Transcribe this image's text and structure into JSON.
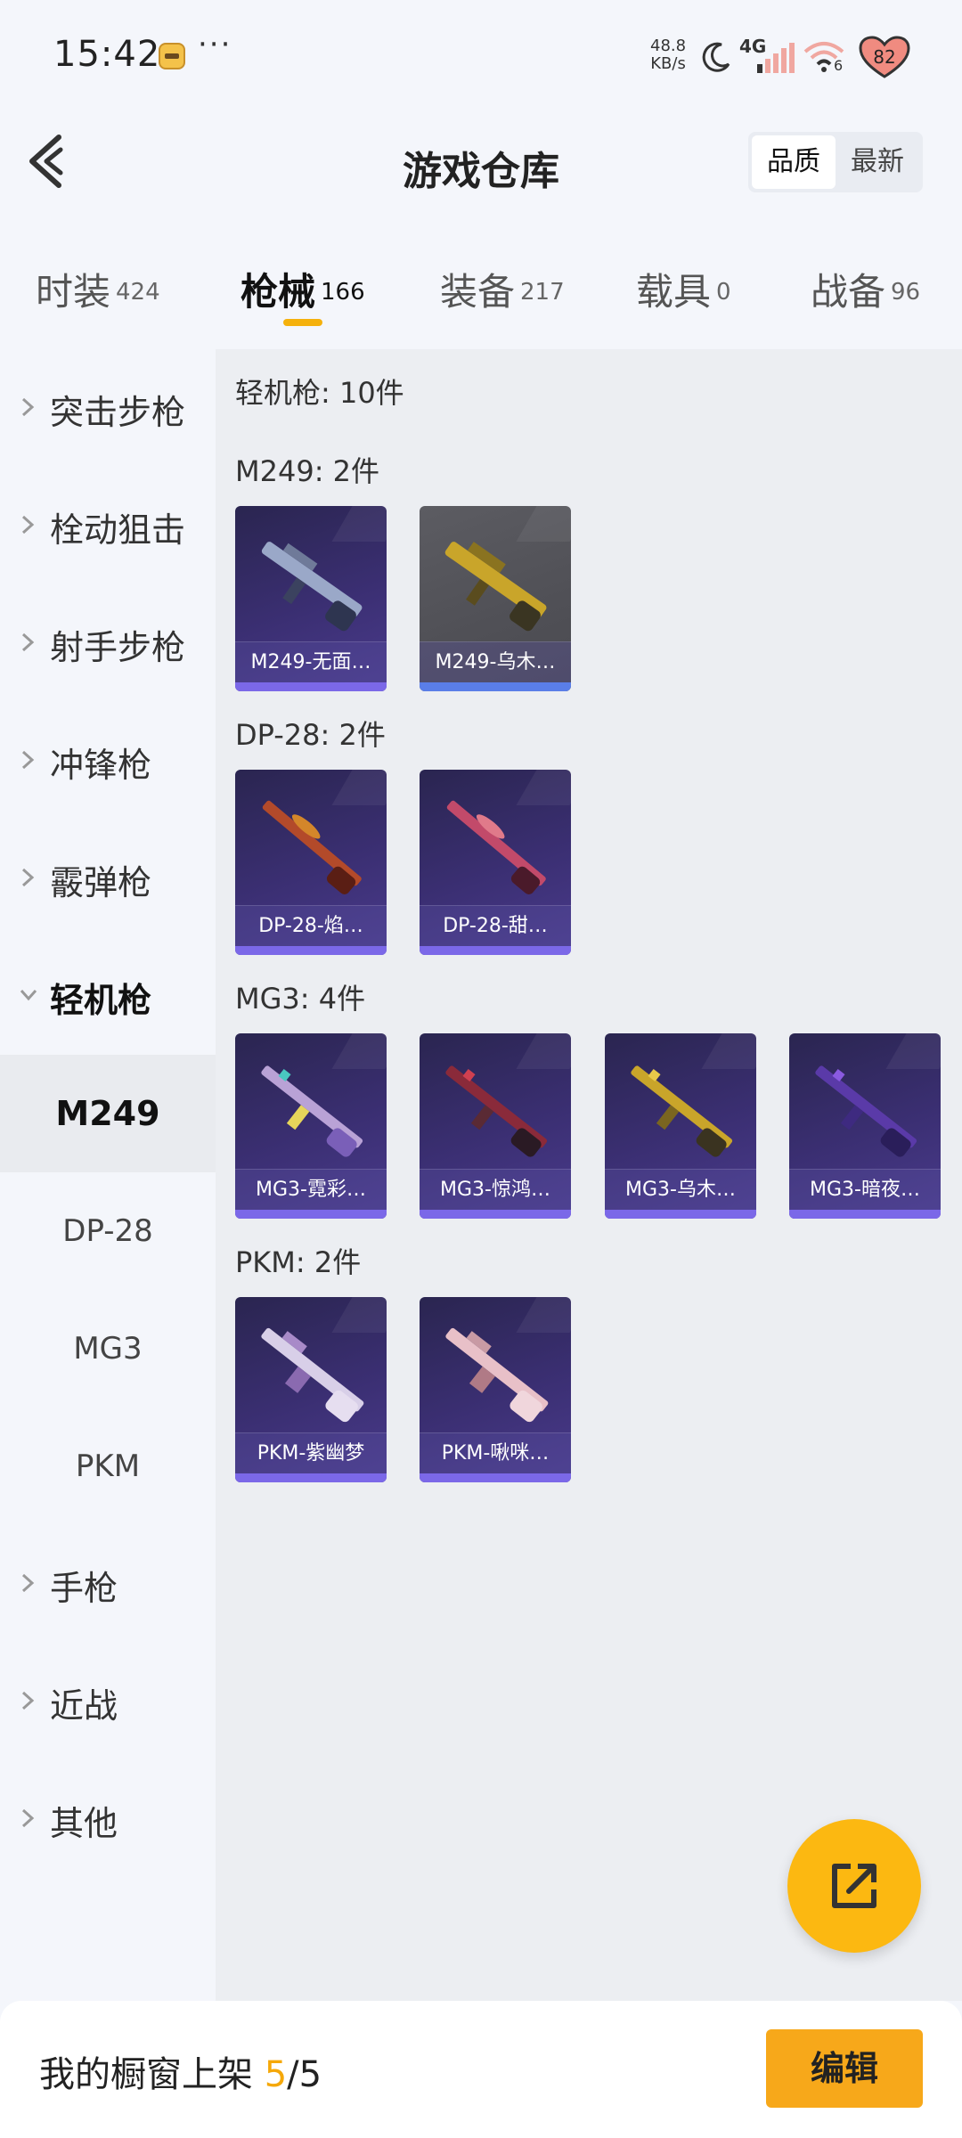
{
  "status_bar": {
    "time": "15:42",
    "more": "···",
    "net_speed_value": "48.8",
    "net_speed_unit": "KB/s",
    "network_type": "4G",
    "wifi_sub": "6",
    "battery": "82"
  },
  "header": {
    "title": "游戏仓库",
    "sort_quality": "品质",
    "sort_latest": "最新"
  },
  "tabs": [
    {
      "label": "时装",
      "count": "424"
    },
    {
      "label": "枪械",
      "count": "166"
    },
    {
      "label": "装备",
      "count": "217"
    },
    {
      "label": "载具",
      "count": "0"
    },
    {
      "label": "战备",
      "count": "96"
    }
  ],
  "sidebar": {
    "categories": [
      "突击步枪",
      "栓动狙击",
      "射手步枪",
      "冲锋枪",
      "霰弹枪",
      "轻机枪",
      "手枪",
      "近战",
      "其他"
    ],
    "subitems": [
      "M249",
      "DP-28",
      "MG3",
      "PKM"
    ]
  },
  "content": {
    "summary": "轻机枪: 10件",
    "groups": [
      {
        "title": "M249: 2件",
        "items": [
          "M249-无面…",
          "M249-乌木…"
        ]
      },
      {
        "title": "DP-28: 2件",
        "items": [
          "DP-28-焰…",
          "DP-28-甜…"
        ]
      },
      {
        "title": "MG3: 4件",
        "items": [
          "MG3-霓彩…",
          "MG3-惊鸿…",
          "MG3-乌木…",
          "MG3-暗夜…"
        ]
      },
      {
        "title": "PKM: 2件",
        "items": [
          "PKM-紫幽梦",
          "PKM-啾咪…"
        ]
      }
    ]
  },
  "bottom": {
    "label": "我的橱窗上架 ",
    "current": "5",
    "total": "/5",
    "edit": "编辑"
  },
  "colors": {
    "accent": "#f5b10c",
    "card_purple": "#3b2f73",
    "card_grey": "#55555b",
    "rarity_purple": "#7b68e8",
    "rarity_blue": "#5a7ee8"
  }
}
